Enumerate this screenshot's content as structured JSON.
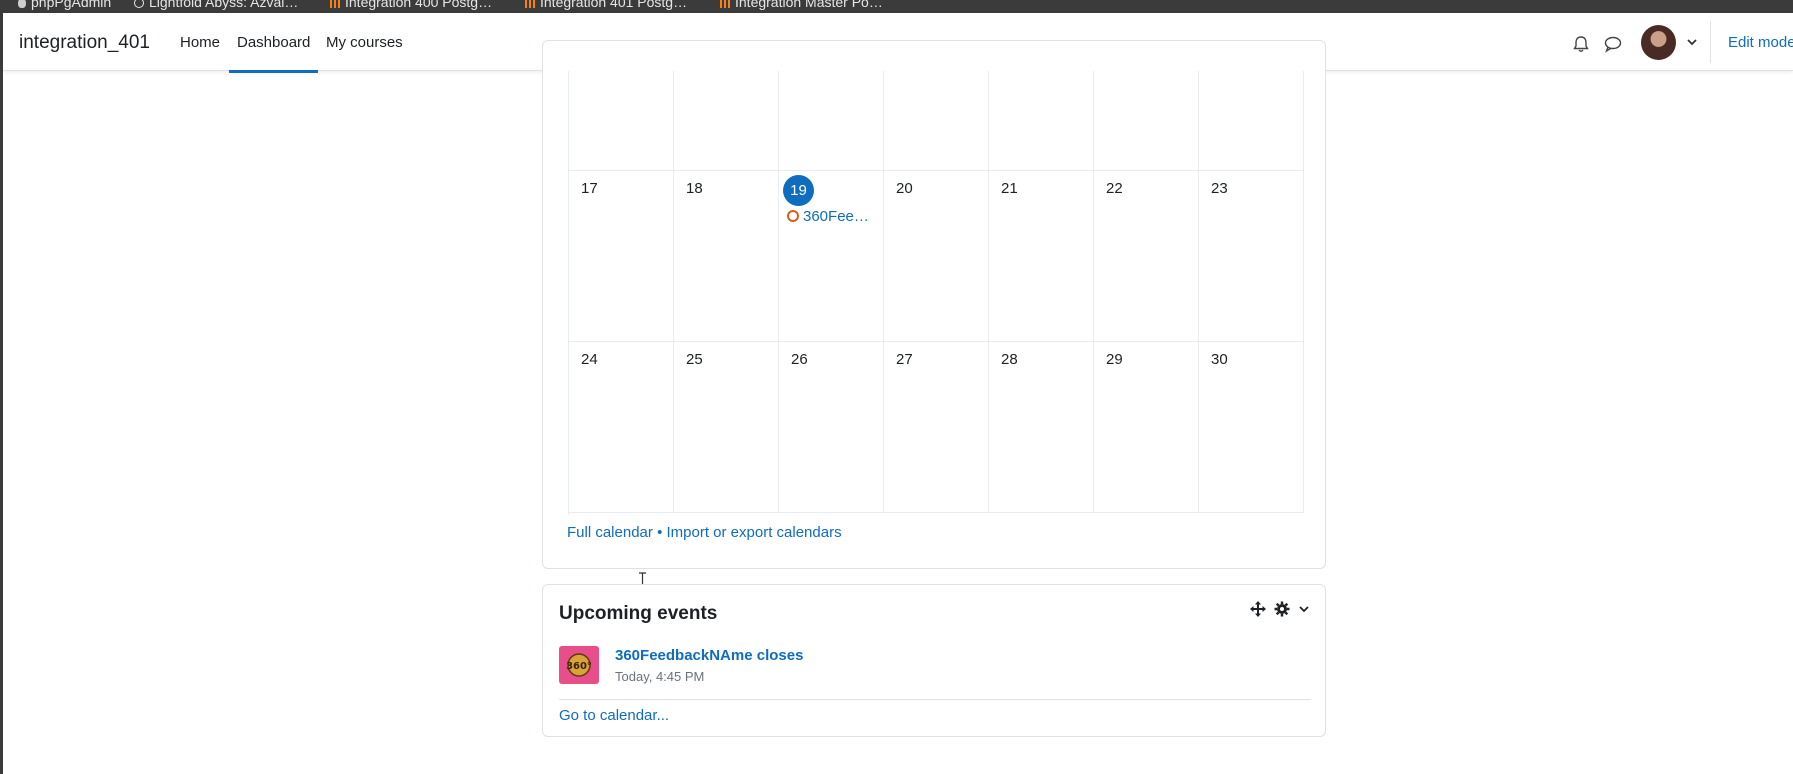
{
  "bookmarks": [
    {
      "label": "phpPgAdmin",
      "icon": "postgres-icon"
    },
    {
      "label": "Lightfold Abyss: Azval…",
      "icon": "globe-icon"
    },
    {
      "label": "Integration 400 Postg…",
      "icon": "moodle-icon"
    },
    {
      "label": "Integration 401 Postg…",
      "icon": "moodle-icon"
    },
    {
      "label": "Integration Master Po…",
      "icon": "moodle-icon"
    }
  ],
  "navbar": {
    "brand": "integration_401",
    "links": {
      "home": "Home",
      "dashboard": "Dashboard",
      "my_courses": "My courses"
    },
    "active_link": "Dashboard",
    "edit_mode": "Edit mode"
  },
  "calendar": {
    "rows": [
      [
        "",
        "",
        "",
        "",
        "",
        "",
        ""
      ],
      [
        "17",
        "18",
        "19",
        "20",
        "21",
        "22",
        "23"
      ],
      [
        "24",
        "25",
        "26",
        "27",
        "28",
        "29",
        "30"
      ]
    ],
    "today": "19",
    "event": {
      "day": "19",
      "label": "360Fee…"
    },
    "footer": {
      "full_calendar": "Full calendar",
      "separator": "•",
      "import_export": "Import or export calendars"
    }
  },
  "upcoming": {
    "title": "Upcoming events",
    "events": [
      {
        "name": "360FeedbackNAme closes",
        "time": "Today, 4:45 PM",
        "thumb_text": "360°"
      }
    ],
    "go_to_calendar": "Go to calendar..."
  },
  "colors": {
    "accent": "#0f6cbf",
    "today_bg": "#0f6cbf",
    "event_dot": "#e05c14",
    "thumb_bg": "#e84e8a"
  }
}
